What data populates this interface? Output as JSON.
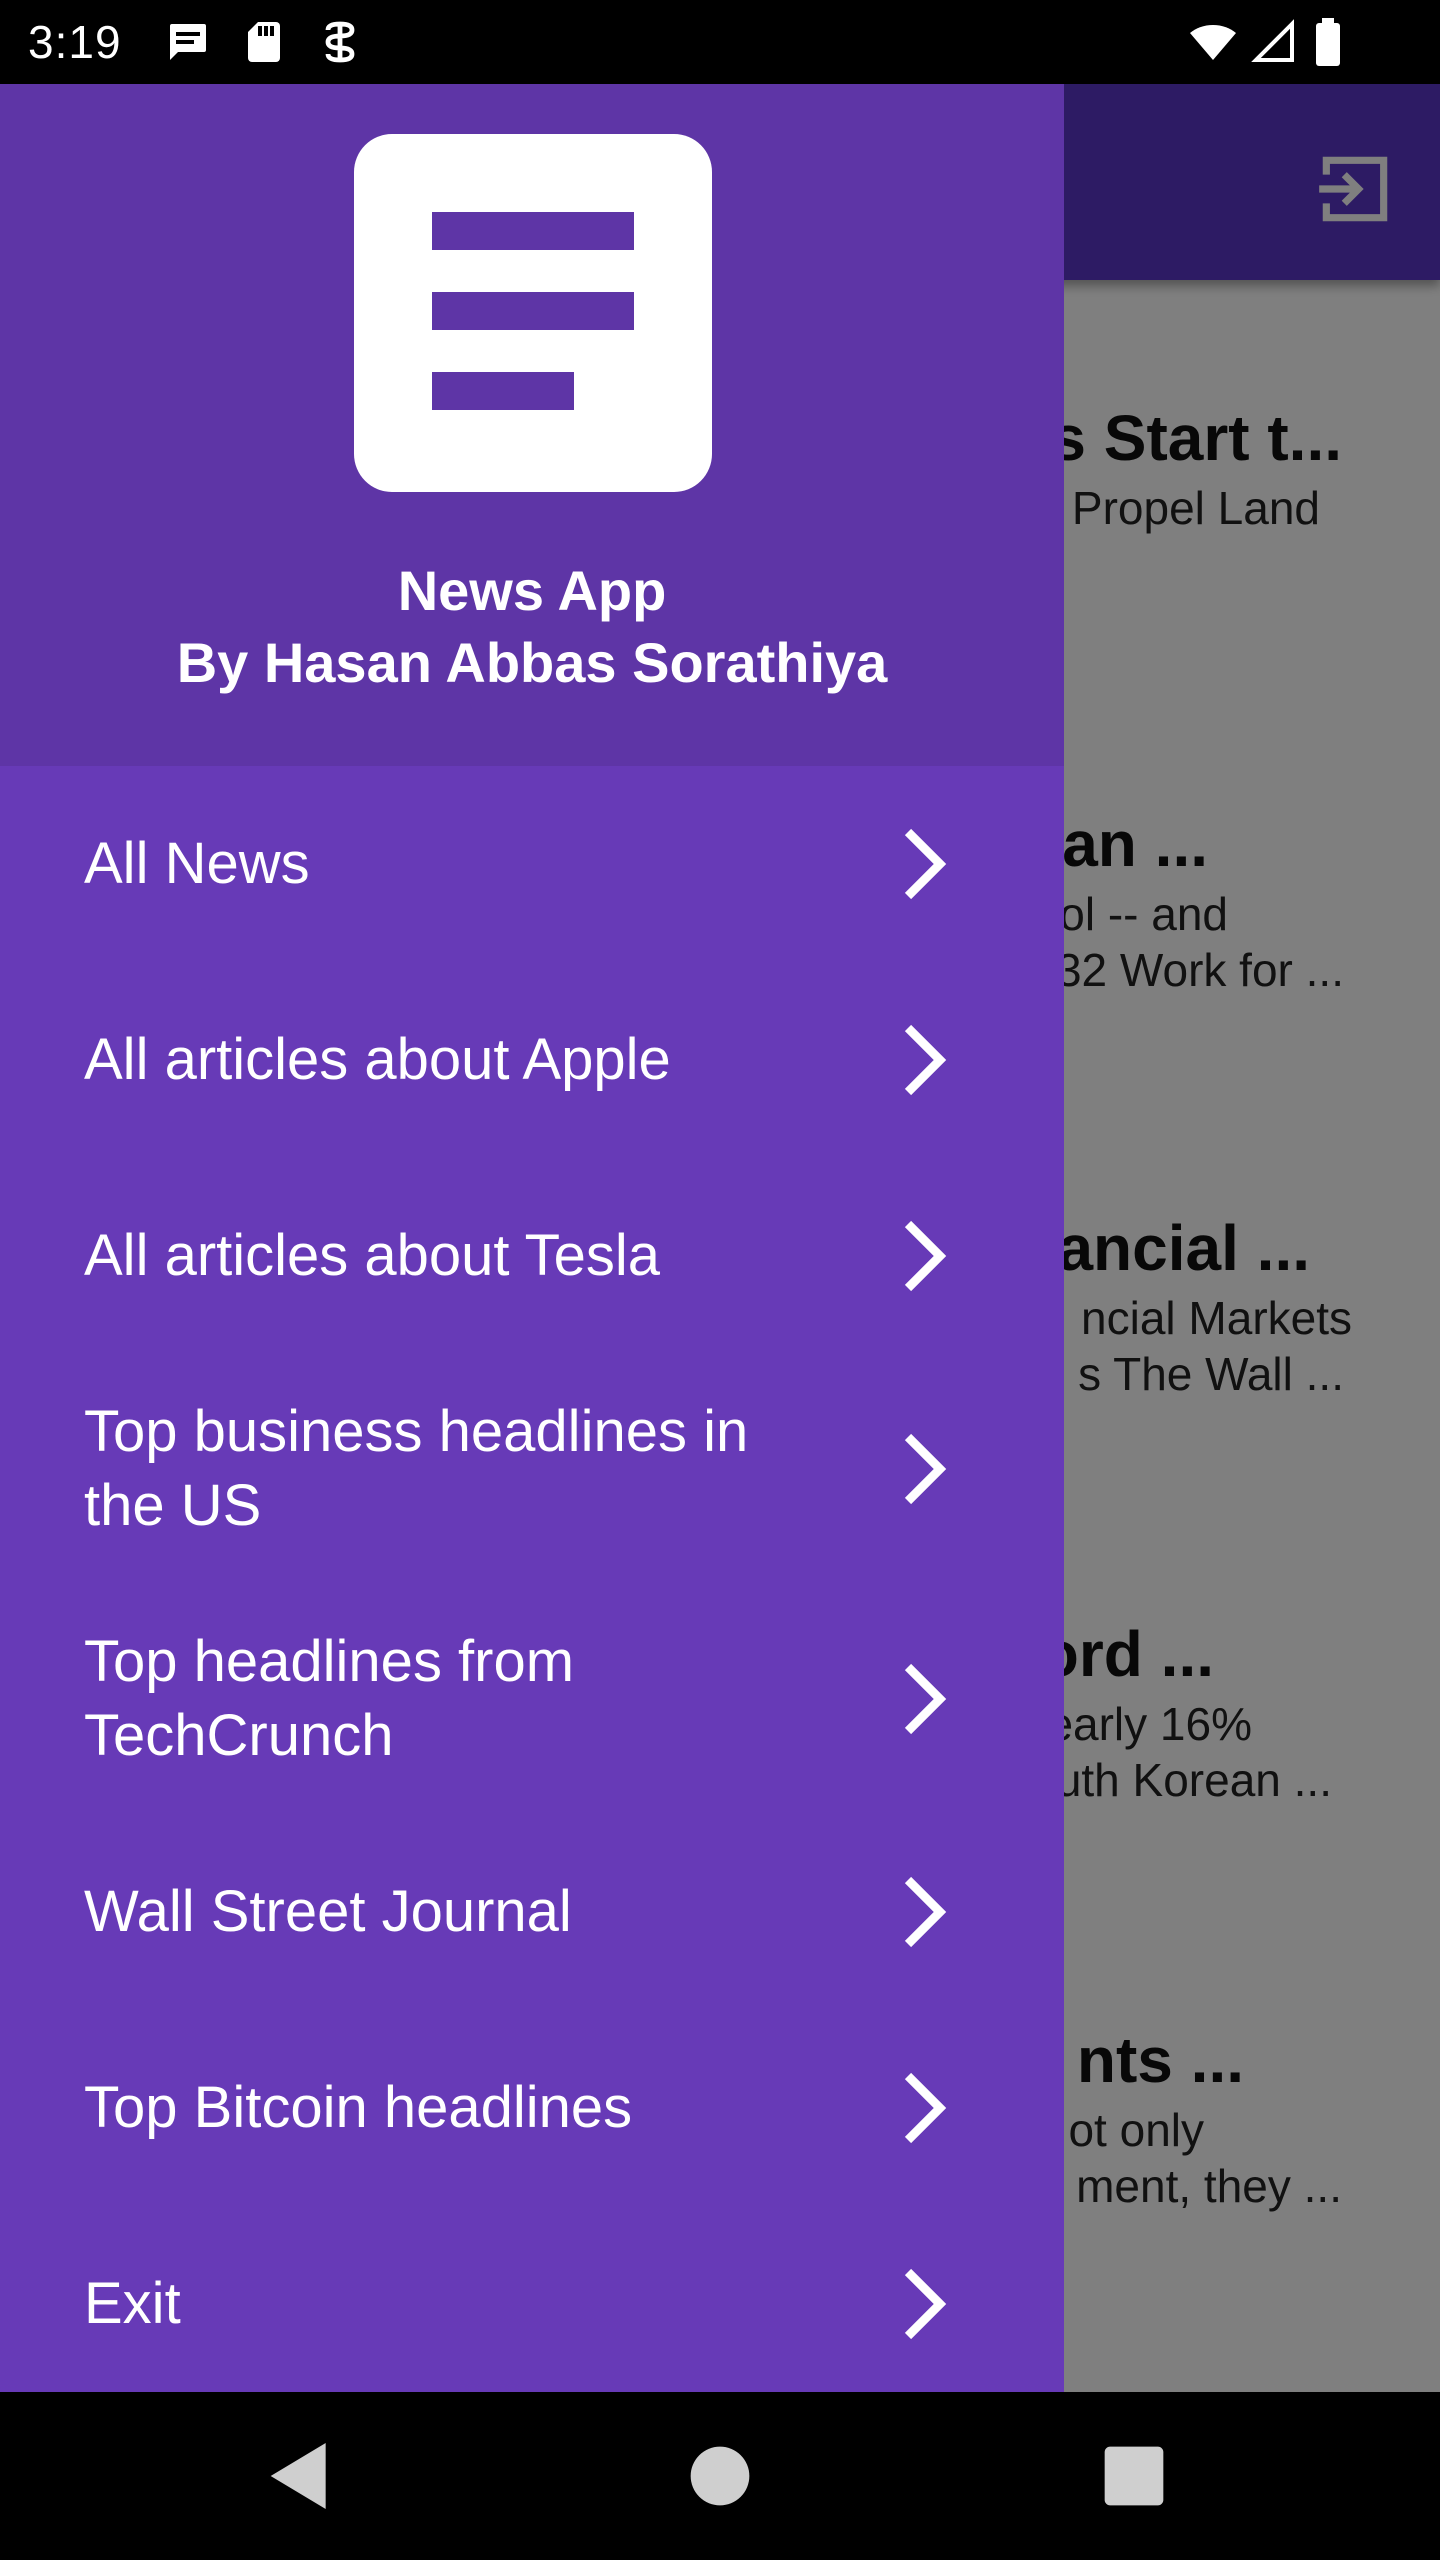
{
  "status_bar": {
    "time": "3:19",
    "icons": [
      "notification-text-icon",
      "sd-card-icon",
      "vpn-key-icon",
      "wifi-icon",
      "signal-icon",
      "battery-icon"
    ]
  },
  "colors": {
    "drawer_background": "#673ab7",
    "drawer_header": "#5e35a6",
    "toolbar": "#5b36c9",
    "text_on_primary": "#ffffff"
  },
  "drawer": {
    "logo_icon": "article-icon",
    "title": "News App",
    "subtitle": "By Hasan Abbas Sorathiya",
    "items": [
      {
        "label": "All News",
        "icon": "chevron-right-icon"
      },
      {
        "label": "All articles about Apple",
        "icon": "chevron-right-icon"
      },
      {
        "label": "All articles about Tesla",
        "icon": "chevron-right-icon"
      },
      {
        "label": "Top business headlines in the US",
        "icon": "chevron-right-icon"
      },
      {
        "label": "Top headlines from TechCrunch",
        "icon": "chevron-right-icon"
      },
      {
        "label": "Wall Street Journal",
        "icon": "chevron-right-icon"
      },
      {
        "label": "Top Bitcoin headlines",
        "icon": "chevron-right-icon"
      },
      {
        "label": "Exit",
        "icon": "chevron-right-icon"
      }
    ]
  },
  "background_app": {
    "toolbar_action_icon": "logout-icon",
    "cards": [
      {
        "title": "s Start t...",
        "lines": [
          "Propel Land"
        ]
      },
      {
        "title": "an ...",
        "lines": [
          "ol -- and",
          "32 Work for ..."
        ]
      },
      {
        "title": "ancial ...",
        "lines": [
          "ncial Markets",
          "s  The Wall ..."
        ]
      },
      {
        "title": "ord ...",
        "lines": [
          "early 16%",
          "uth Korean ..."
        ]
      },
      {
        "title": "nts ...",
        "lines": [
          "ot only",
          "ment, they ..."
        ]
      }
    ]
  },
  "nav_bar": {
    "back_icon": "back-triangle-icon",
    "home_icon": "home-circle-icon",
    "recents_icon": "recents-square-icon"
  }
}
